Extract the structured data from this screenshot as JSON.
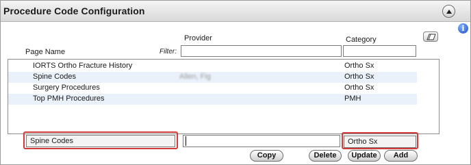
{
  "header": {
    "title": "Procedure Code Configuration"
  },
  "icons": {
    "collapse": "chevron-up-icon",
    "info": "info-icon",
    "clear_filter": "eraser-icon"
  },
  "info_glyph": "i",
  "columns": {
    "provider": "Provider",
    "category": "Category",
    "page_name": "Page Name"
  },
  "filter": {
    "label": "Filter:",
    "page_name_value": "",
    "provider_value": "",
    "category_value": ""
  },
  "rows": [
    {
      "name": "IORTS Ortho Fracture History",
      "provider": "",
      "category": "Ortho Sx"
    },
    {
      "name": "Spine Codes",
      "provider": "Allen, Fig",
      "category": "Ortho Sx"
    },
    {
      "name": "Surgery Procedures",
      "provider": "",
      "category": "Ortho Sx"
    },
    {
      "name": "Top PMH Procedures",
      "provider": "",
      "category": "PMH"
    }
  ],
  "edit": {
    "page_name": "Spine Codes",
    "provider": "",
    "category": "Ortho Sx"
  },
  "buttons": {
    "copy": "Copy",
    "delete": "Delete",
    "update": "Update",
    "add": "Add"
  },
  "colors": {
    "highlight": "#d23a3a",
    "row_alt": "#eaf1fb",
    "header_bg": "#d9d9d9"
  }
}
